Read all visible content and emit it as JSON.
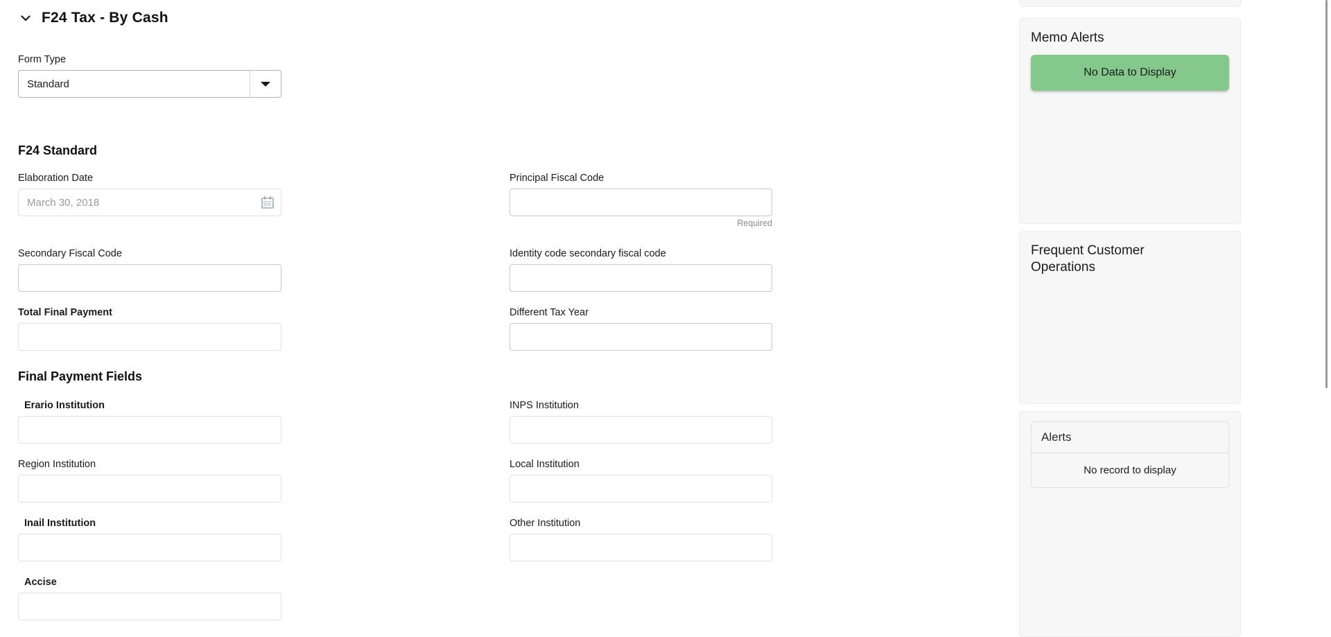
{
  "section": {
    "title": "F24 Tax - By  Cash",
    "collapse_icon": "chevron-down-icon"
  },
  "form_type": {
    "label": "Form Type",
    "value": "Standard",
    "dropdown_icon": "caret-down-icon"
  },
  "f24_standard": {
    "heading": "F24 Standard",
    "fields": {
      "elaboration_date": {
        "label": "Elaboration Date",
        "placeholder": "March 30, 2018",
        "value": "",
        "icon": "calendar-icon"
      },
      "principal_fiscal_code": {
        "label": "Principal Fiscal Code",
        "value": "",
        "hint": "Required"
      },
      "secondary_fiscal_code": {
        "label": "Secondary Fiscal Code",
        "value": ""
      },
      "identity_code_secondary_fiscal_code": {
        "label": "Identity code secondary fiscal code",
        "value": ""
      },
      "total_final_payment": {
        "label": "Total Final Payment",
        "value": ""
      },
      "different_tax_year": {
        "label": "Different Tax Year",
        "value": ""
      }
    }
  },
  "final_payment_fields": {
    "heading": "Final Payment Fields",
    "fields": {
      "erario_institution": {
        "label": "Erario Institution",
        "value": ""
      },
      "inps_institution": {
        "label": "INPS Institution",
        "value": ""
      },
      "region_institution": {
        "label": "Region Institution",
        "value": ""
      },
      "local_institution": {
        "label": "Local Institution",
        "value": ""
      },
      "inail_institution": {
        "label": "Inail Institution",
        "value": ""
      },
      "other_institution": {
        "label": "Other Institution",
        "value": ""
      },
      "accise": {
        "label": "Accise",
        "value": ""
      }
    }
  },
  "sidebar": {
    "memo_alerts": {
      "title": "Memo Alerts",
      "badge": "No Data to Display",
      "badge_color": "#84c98b"
    },
    "frequent_customer_operations": {
      "title": "Frequent Customer Operations"
    },
    "alerts": {
      "header": "Alerts",
      "empty_message": "No record to display"
    }
  }
}
